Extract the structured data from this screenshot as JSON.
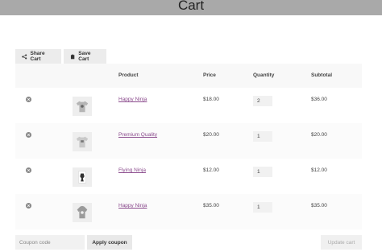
{
  "page": {
    "title": "Cart"
  },
  "toolbar": {
    "share_label": "Share Cart",
    "save_label": "Save Cart"
  },
  "table": {
    "headers": {
      "product": "Product",
      "price": "Price",
      "quantity": "Quantity",
      "subtotal": "Subtotal"
    },
    "rows": [
      {
        "product": "Happy Ninja",
        "price": "$18.00",
        "quantity": "2",
        "subtotal": "$36.00"
      },
      {
        "product": "Premium Quality",
        "price": "$20.00",
        "quantity": "1",
        "subtotal": "$20.00"
      },
      {
        "product": "Flying Ninja",
        "price": "$12.00",
        "quantity": "1",
        "subtotal": "$12.00"
      },
      {
        "product": "Happy Ninja",
        "price": "$35.00",
        "quantity": "1",
        "subtotal": "$35.00"
      }
    ]
  },
  "coupon": {
    "placeholder": "Coupon code",
    "apply_label": "Apply coupon"
  },
  "update_label": "Update cart"
}
